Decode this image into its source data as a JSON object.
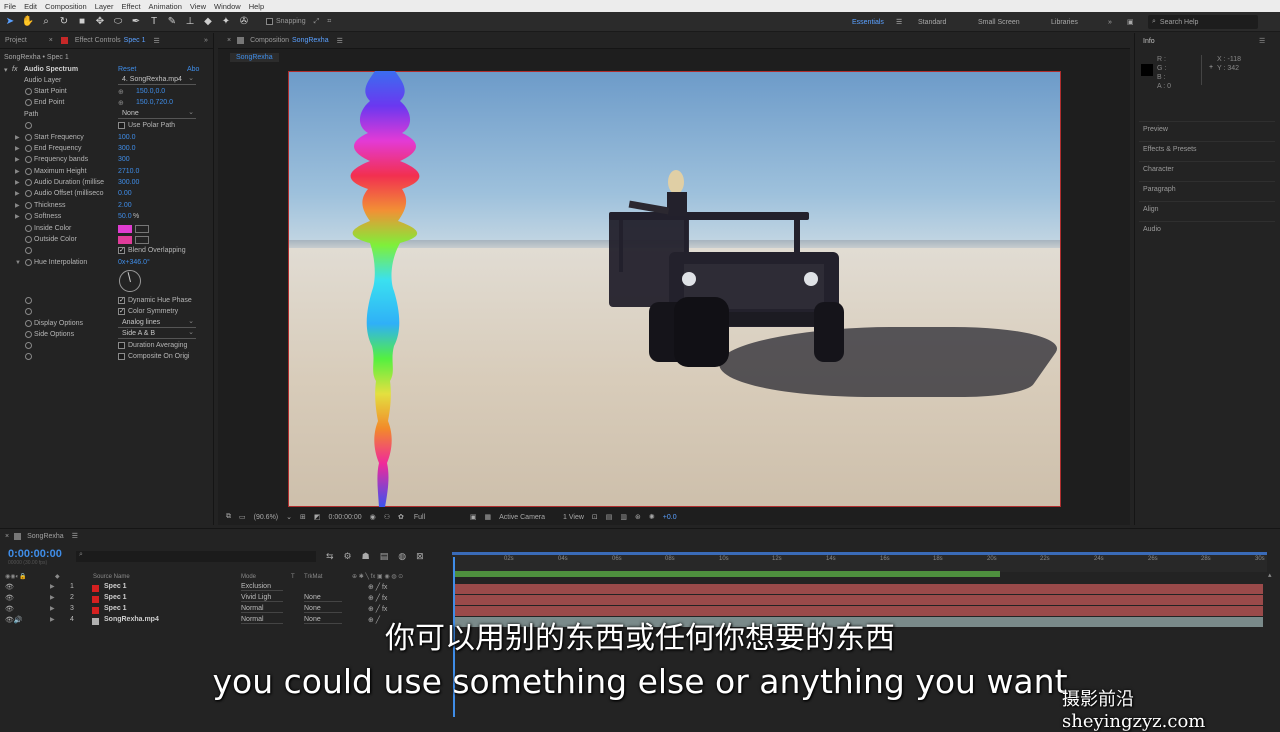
{
  "menu": [
    "File",
    "Edit",
    "Composition",
    "Layer",
    "Effect",
    "Animation",
    "View",
    "Window",
    "Help"
  ],
  "toolbar": {
    "snapping_label": "Snapping",
    "workspaces": [
      "Essentials",
      "Standard",
      "Small Screen",
      "Libraries"
    ],
    "active_workspace": "Essentials",
    "search_placeholder": "Search Help"
  },
  "effect_panel": {
    "tabs": [
      "Project",
      "Effect Controls",
      "Spec 1"
    ],
    "breadcrumb": "SongRexha • Spec 1",
    "effect_name": "Audio Spectrum",
    "reset_label": "Reset",
    "about_label": "Abo",
    "audio_layer_label": "Audio Layer",
    "audio_layer_value": "4. SongRexha.mp4",
    "start_point_label": "Start Point",
    "start_point_value": "150.0,0.0",
    "end_point_label": "End Point",
    "end_point_value": "150.0,720.0",
    "path_label": "Path",
    "path_value": "None",
    "use_polar_path": "Use Polar Path",
    "start_frequency_label": "Start Frequency",
    "start_frequency_value": "100.0",
    "end_frequency_label": "End Frequency",
    "end_frequency_value": "300.0",
    "frequency_bands_label": "Frequency bands",
    "frequency_bands_value": "300",
    "maximum_height_label": "Maximum Height",
    "maximum_height_value": "2710.0",
    "audio_duration_label": "Audio Duration (millise",
    "audio_duration_value": "300.00",
    "audio_offset_label": "Audio Offset (milliseco",
    "audio_offset_value": "0.00",
    "thickness_label": "Thickness",
    "thickness_value": "2.00",
    "softness_label": "Softness",
    "softness_value": "50.0",
    "softness_unit": "%",
    "inside_color_label": "Inside Color",
    "outside_color_label": "Outside Color",
    "blend_overlapping": "Blend Overlapping",
    "hue_interpolation_label": "Hue Interpolation",
    "hue_interpolation_value": "0x+346.0°",
    "dynamic_hue_phase": "Dynamic Hue Phase",
    "color_symmetry": "Color Symmetry",
    "display_options_label": "Display Options",
    "display_options_value": "Analog lines",
    "side_options_label": "Side Options",
    "side_options_value": "Side A & B",
    "duration_averaging": "Duration Averaging",
    "composite_on_original": "Composite On Origi"
  },
  "composition": {
    "tab_label": "Composition",
    "comp_name": "SongRexha",
    "sub_tab": "SongRexha",
    "zoom": "(90.6%)",
    "timecode": "0:00:00:00",
    "resolution": "Full",
    "camera": "Active Camera",
    "views": "1 View",
    "exposure": "+0.0"
  },
  "right_panel": {
    "info_title": "Info",
    "info_r": "R :",
    "info_g": "G :",
    "info_b": "B :",
    "info_a": "A : 0",
    "info_x": "X : -118",
    "info_y": "Y : 342",
    "sections": [
      "Preview",
      "Effects & Presets",
      "Character",
      "Paragraph",
      "Align",
      "Audio"
    ]
  },
  "timeline": {
    "comp_name": "SongRexha",
    "current_time": "0:00:00:00",
    "time_sub": "00000 (30.00 fps)",
    "col_source": "Source Name",
    "col_mode": "Mode",
    "col_t": "T",
    "col_trkmat": "TrkMat",
    "ruler": [
      "02s",
      "04s",
      "06s",
      "08s",
      "10s",
      "12s",
      "14s",
      "16s",
      "18s",
      "20s",
      "22s",
      "24s",
      "26s",
      "28s",
      "30s"
    ],
    "layers": [
      {
        "num": "1",
        "name": "Spec 1",
        "mode": "Exclusion",
        "trkmat": "",
        "color": "#d42020"
      },
      {
        "num": "2",
        "name": "Spec 1",
        "mode": "Vivid Ligh",
        "trkmat": "None",
        "color": "#d42020"
      },
      {
        "num": "3",
        "name": "Spec 1",
        "mode": "Normal",
        "trkmat": "None",
        "color": "#d42020"
      },
      {
        "num": "4",
        "name": "SongRexha.mp4",
        "mode": "Normal",
        "trkmat": "None",
        "color": "#b0b0b0"
      }
    ]
  },
  "subtitles": {
    "chinese": "你可以用别的东西或任何你想要的东西",
    "english": "you could use something else or anything you want",
    "watermark": "摄影前沿 sheyingzyz.com"
  },
  "colors": {
    "accent": "#3f8de8",
    "inside_color": "#e03cd0",
    "outside_color": "#e03c9a",
    "layer_bar": "#9a4a4a",
    "video_bar": "#7a8a8a"
  }
}
